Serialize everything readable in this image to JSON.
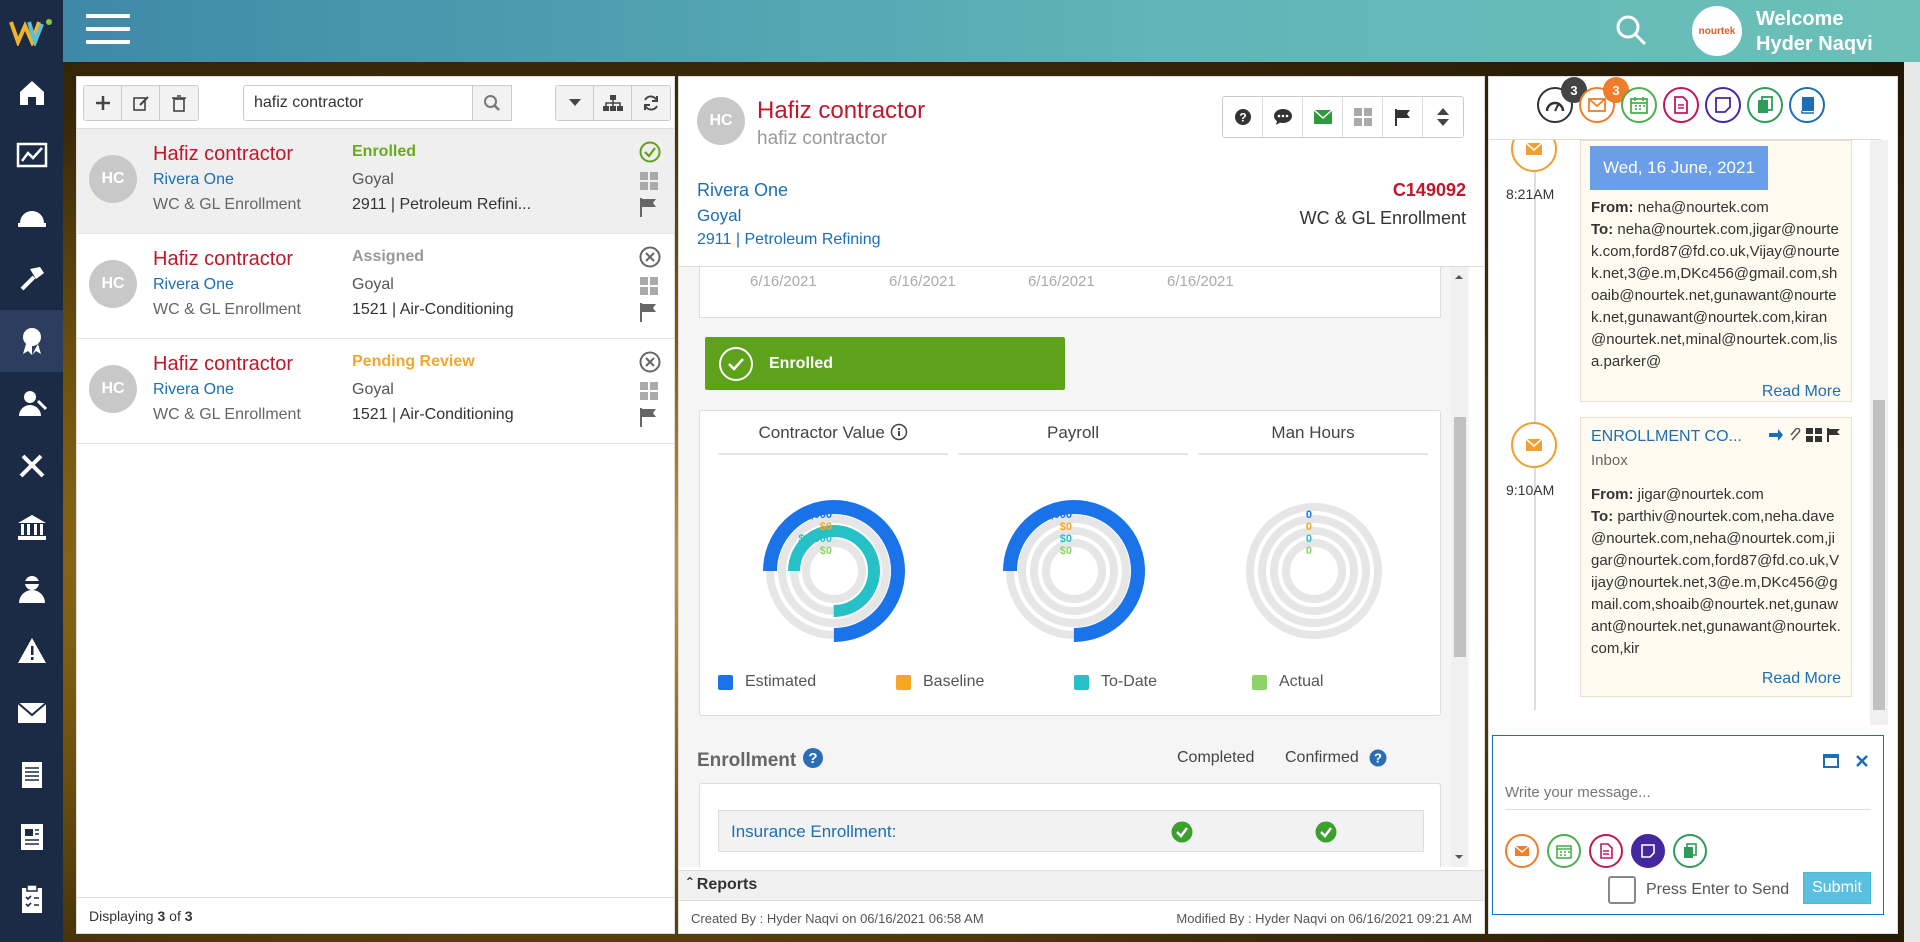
{
  "header": {
    "welcome_line1": "Welcome",
    "welcome_line2": "Hyder Naqvi",
    "avatar_brand": "nourtek"
  },
  "sidebar": {
    "items": [
      "home-icon",
      "analytics-icon",
      "helmet-icon",
      "hammer-icon",
      "award-icon",
      "worker-icon",
      "tools-icon",
      "bank-icon",
      "agent-icon",
      "warning-icon",
      "mail-icon",
      "document-icon",
      "report-icon",
      "clipboard-icon"
    ],
    "active_index": 4
  },
  "list": {
    "search_value": "hafiz contractor",
    "rows": [
      {
        "initials": "HC",
        "name": "Hafiz contractor",
        "company": "Rivera One",
        "type": "WC & GL Enrollment",
        "status": "Enrolled",
        "status_color": "#6aaa1e",
        "owner": "Goyal",
        "class": "2911 | Petroleum Refini..."
      },
      {
        "initials": "HC",
        "name": "Hafiz contractor",
        "company": "Rivera One",
        "type": "WC & GL Enrollment",
        "status": "Assigned",
        "status_color": "#999999",
        "owner": "Goyal",
        "class": "1521 | Air-Conditioning"
      },
      {
        "initials": "HC",
        "name": "Hafiz contractor",
        "company": "Rivera One",
        "type": "WC & GL Enrollment",
        "status": "Pending Review",
        "status_color": "#f0a830",
        "owner": "Goyal",
        "class": "1521 | Air-Conditioning"
      }
    ],
    "footer_prefix": "Displaying ",
    "footer_shown": "3",
    "footer_of": " of ",
    "footer_total": "3"
  },
  "detail": {
    "initials": "HC",
    "title": "Hafiz contractor",
    "subtitle": "hafiz contractor",
    "company": "Rivera One",
    "owner": "Goyal",
    "class_code": "2911 | Petroleum Refining",
    "code": "C149092",
    "type": "WC & GL Enrollment",
    "dates": [
      "6/16/2021",
      "6/16/2021",
      "6/16/2021",
      "6/16/2021"
    ],
    "status_button": "Enrolled",
    "chart_tabs": [
      "Contractor Value",
      "Payroll",
      "Man Hours"
    ],
    "legend": [
      {
        "label": "Estimated",
        "color": "#1a73e8"
      },
      {
        "label": "Baseline",
        "color": "#f5a623"
      },
      {
        "label": "To-Date",
        "color": "#26c0c7"
      },
      {
        "label": "Actual",
        "color": "#8cd46a"
      }
    ],
    "enrollment_title": "Enrollment",
    "col_completed": "Completed",
    "col_confirmed": "Confirmed",
    "insurance_label": "Insurance Enrollment:",
    "reports_label": "Reports",
    "created_by": "Created By : Hyder Naqvi on 06/16/2021 06:58 AM",
    "modified_by": "Modified By : Hyder Naqvi on 06/16/2021 09:21 AM"
  },
  "chart_data": [
    {
      "type": "donut",
      "title": "Contractor Value",
      "series": [
        {
          "name": "Estimated",
          "value": "$5,000"
        },
        {
          "name": "Baseline",
          "value": "$0"
        },
        {
          "name": "To-Date",
          "value": "$5,000"
        },
        {
          "name": "Actual",
          "value": "$0"
        }
      ]
    },
    {
      "type": "donut",
      "title": "Payroll",
      "series": [
        {
          "name": "Estimated",
          "value": "$5,000"
        },
        {
          "name": "Baseline",
          "value": "$0"
        },
        {
          "name": "To-Date",
          "value": "$0"
        },
        {
          "name": "Actual",
          "value": "$0"
        }
      ]
    },
    {
      "type": "donut",
      "title": "Man Hours",
      "series": [
        {
          "name": "Estimated",
          "value": "0"
        },
        {
          "name": "Baseline",
          "value": "0"
        },
        {
          "name": "To-Date",
          "value": "0"
        },
        {
          "name": "Actual",
          "value": "0"
        }
      ]
    }
  ],
  "activity": {
    "badge_count_1": "3",
    "badge_count_2": "3",
    "date_badge": "Wed, 16 June, 2021",
    "items": [
      {
        "time": "8:21AM",
        "from_label": "From:",
        "from": "neha@nourtek.com",
        "to_label": "To:",
        "to": "neha@nourtek.com,jigar@nourtek.com,ford87@fd.co.uk,Vijay@nourtek.net,3@e.m,DKc456@gmail.com,shoaib@nourtek.net,gunawant@nourtek.net,gunawant@nourtek.com,kiran@nourtek.net,minal@nourtek.com,lisa.parker@",
        "more": "Read More"
      },
      {
        "time": "9:10AM",
        "subject": "ENROLLMENT CO...",
        "folder": "Inbox",
        "from_label": "From:",
        "from": "jigar@nourtek.com",
        "to_label": "To:",
        "to": "parthiv@nourtek.com,neha.dave@nourtek.com,neha@nourtek.com,jigar@nourtek.com,ford87@fd.co.uk,Vijay@nourtek.net,3@e.m,DKc456@gmail.com,shoaib@nourtek.net,gunawant@nourtek.net,gunawant@nourtek.com,kir",
        "more": "Read More"
      }
    ],
    "message_placeholder": "Write your message...",
    "enter_label": "Press Enter to Send",
    "submit_label": "Submit"
  }
}
